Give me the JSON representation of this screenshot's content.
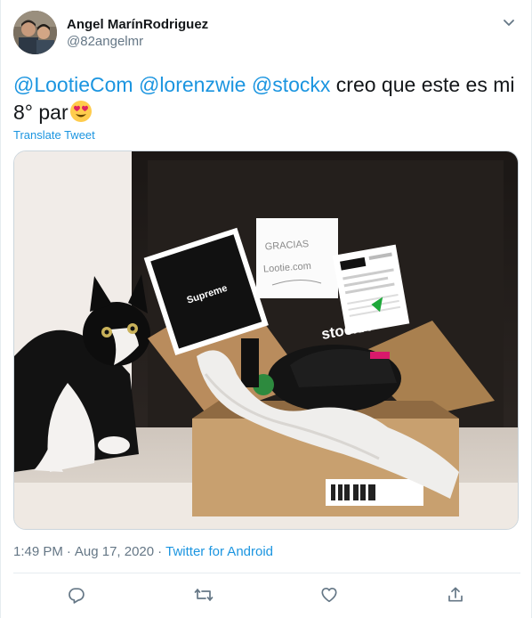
{
  "user": {
    "name": "Angel MarínRodriguez",
    "handle": "@82angelmr"
  },
  "tweet": {
    "mentions": [
      "@LootieCom",
      "@lorenzwie",
      "@stockx"
    ],
    "text": "creo que este es mi 8° par",
    "translate_label": "Translate Tweet"
  },
  "photo": {
    "card_text": "GRACIAS\nLootie.com",
    "box_brand": "stockX",
    "supreme_label": "Supreme"
  },
  "meta": {
    "time": "1:49 PM",
    "date": "Aug 17, 2020",
    "separator": "·",
    "source": "Twitter for Android"
  },
  "icons": {
    "more": "chevron-down-icon",
    "reply": "reply-icon",
    "retweet": "retweet-icon",
    "like": "heart-icon",
    "share": "share-icon"
  },
  "colors": {
    "link": "#1b95e0",
    "secondary": "#657786",
    "text": "#14171a",
    "border": "#e6ecf0"
  }
}
